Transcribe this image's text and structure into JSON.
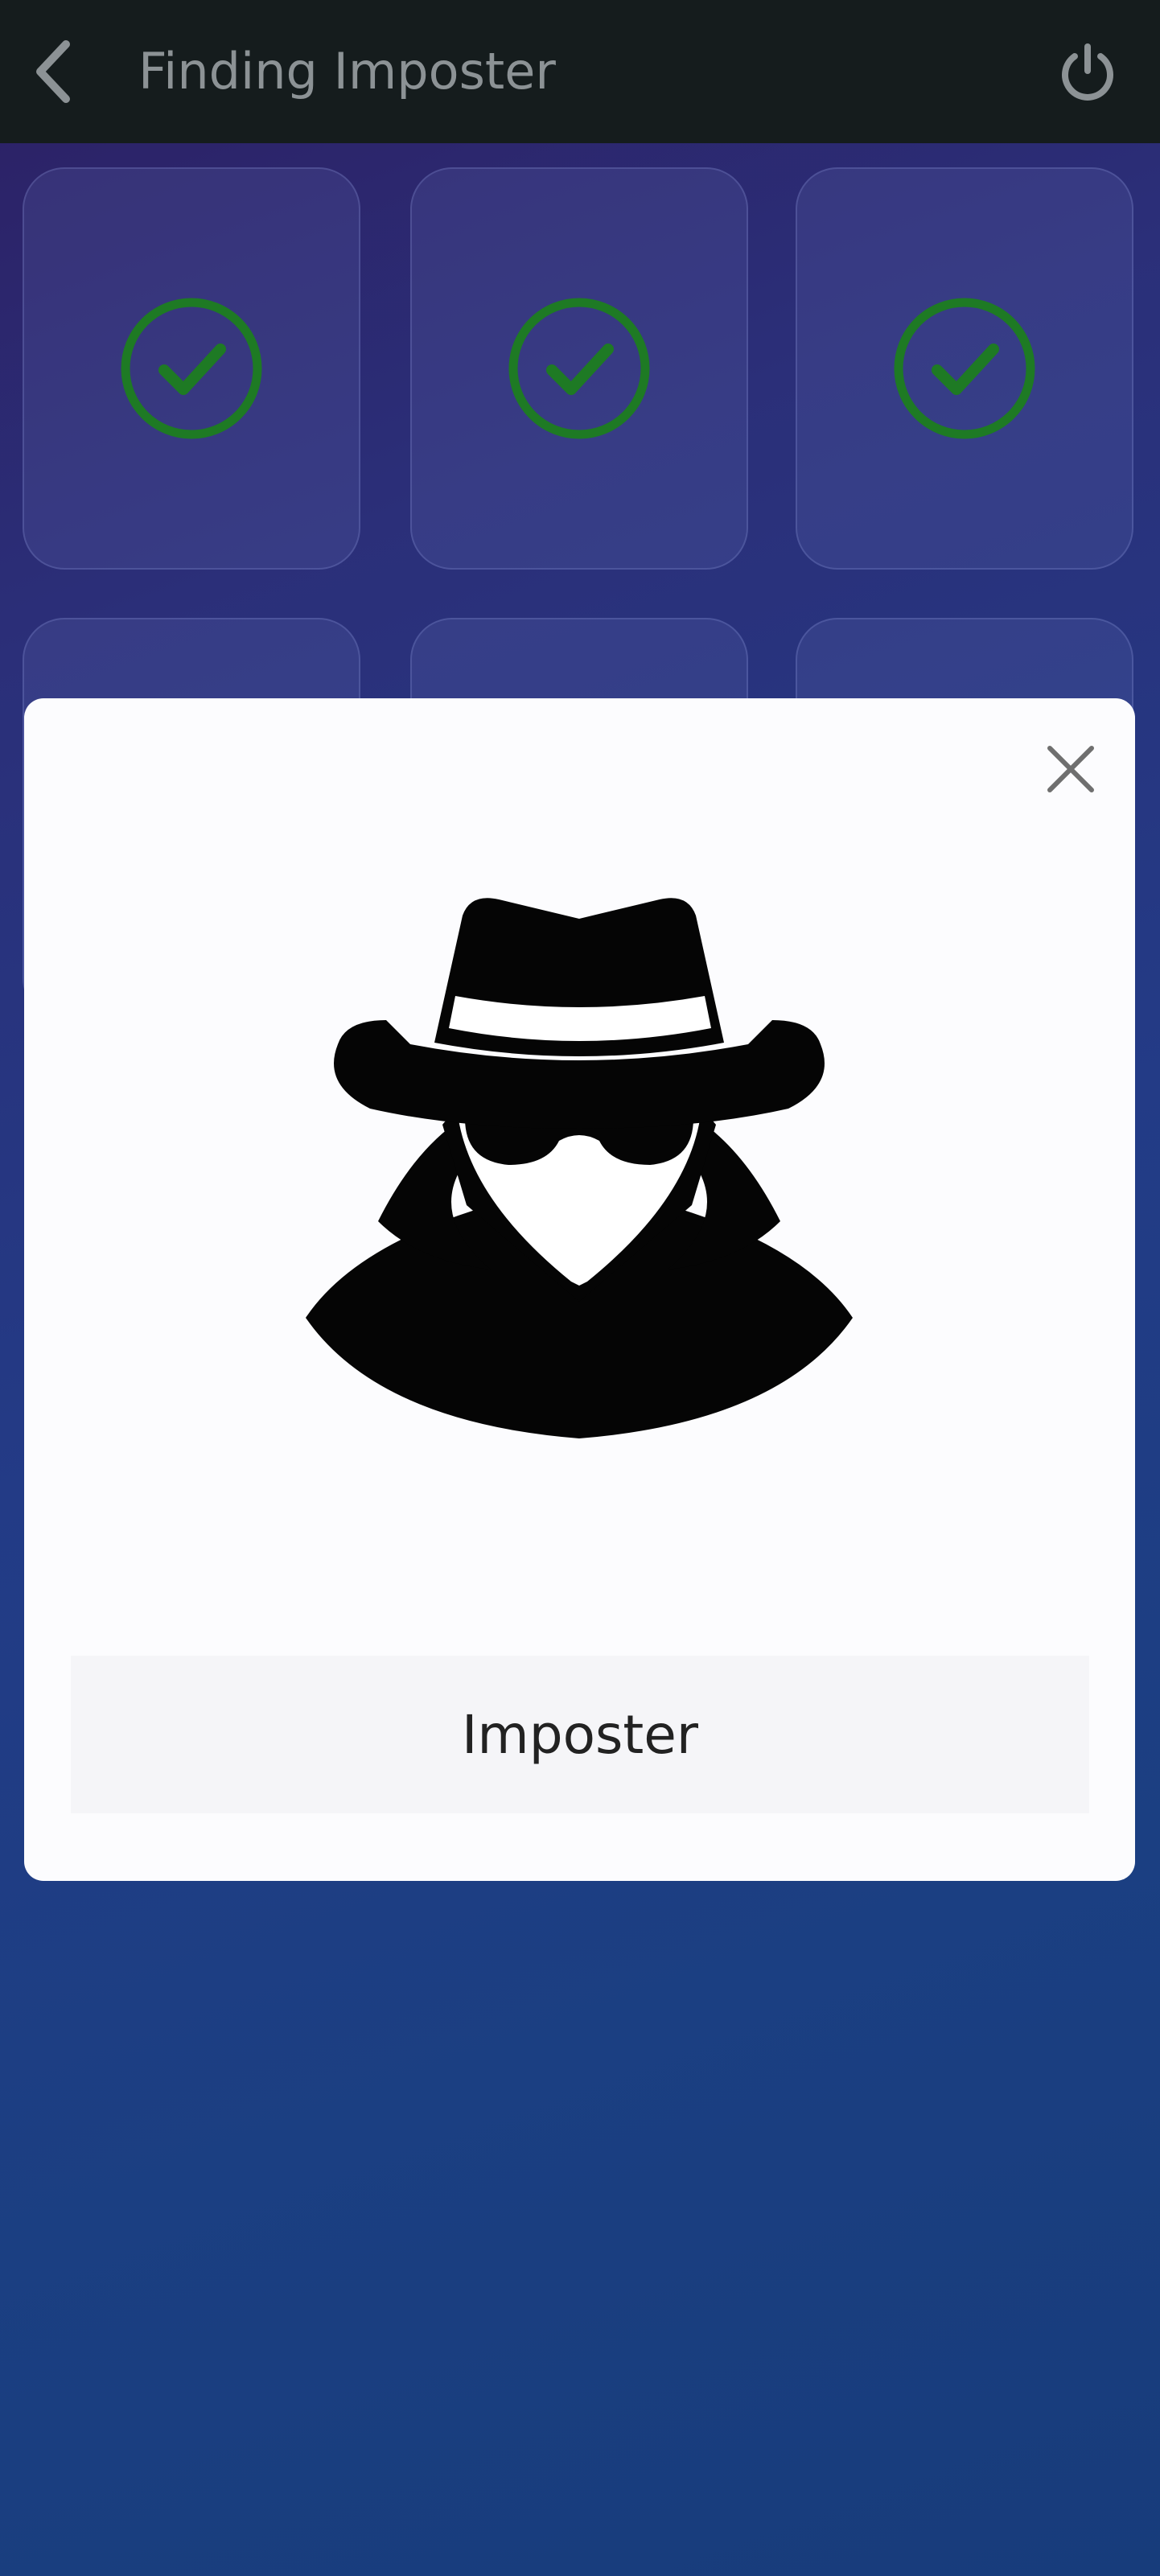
{
  "header": {
    "title": "Finding Imposter",
    "back_icon": "chevron-left-icon",
    "power_icon": "power-icon"
  },
  "grid": {
    "cards": [
      {
        "status": "checked",
        "icon": "check-circle-icon"
      },
      {
        "status": "checked",
        "icon": "check-circle-icon"
      },
      {
        "status": "checked",
        "icon": "check-circle-icon"
      },
      {
        "status": "hidden"
      },
      {
        "status": "hidden"
      },
      {
        "status": "hidden"
      }
    ]
  },
  "modal": {
    "close_icon": "close-icon",
    "illustration": "spy-icon",
    "role_label": "Imposter"
  },
  "colors": {
    "topbar": "#151c1d",
    "check_green": "#1e7a24",
    "modal_bg": "#fcfcfe"
  }
}
